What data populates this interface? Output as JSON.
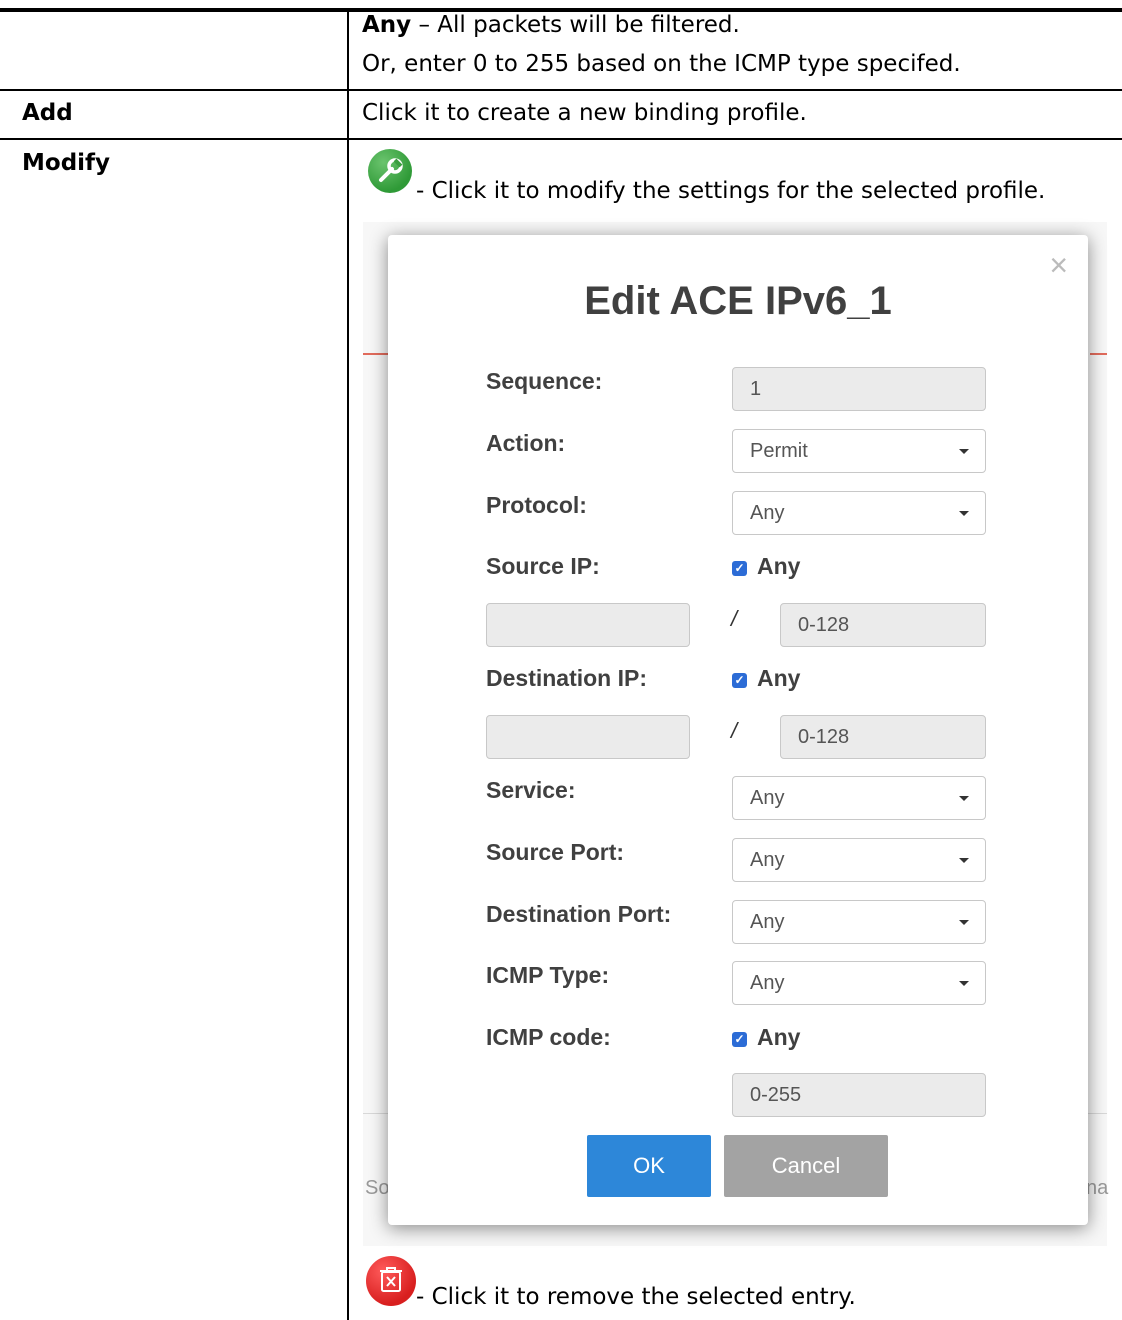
{
  "table": {
    "row_any": {
      "bold": "Any",
      "rest": " – All packets will be filtered.",
      "line2": "Or, enter 0 to 255 based on the ICMP type specifed."
    },
    "row_add": {
      "label": "Add",
      "desc": "Click it to create a new binding profile."
    },
    "row_modify": {
      "label": "Modify",
      "desc": "- Click it to modify the settings for the selected profile.",
      "remove_desc": "- Click it to remove the selected entry."
    }
  },
  "dialog": {
    "title": "Edit ACE IPv6_1",
    "close_symbol": "×",
    "sequence": {
      "label": "Sequence:",
      "value": "1"
    },
    "action": {
      "label": "Action:",
      "value": "Permit"
    },
    "protocol": {
      "label": "Protocol:",
      "value": "Any"
    },
    "source_ip": {
      "label": "Source IP:",
      "any_label": "Any",
      "any_checked": true,
      "slash": "/",
      "prefix_placeholder": "0-128"
    },
    "destination_ip": {
      "label": "Destination IP:",
      "any_label": "Any",
      "any_checked": true,
      "slash": "/",
      "prefix_placeholder": "0-128"
    },
    "service": {
      "label": "Service:",
      "value": "Any"
    },
    "source_port": {
      "label": "Source Port:",
      "value": "Any"
    },
    "destination_port": {
      "label": "Destination Port:",
      "value": "Any"
    },
    "icmp_type": {
      "label": "ICMP Type:",
      "value": "Any"
    },
    "icmp_code": {
      "label": "ICMP code:",
      "any_label": "Any",
      "any_checked": true,
      "placeholder": "0-255"
    },
    "ok_label": "OK",
    "cancel_label": "Cancel"
  },
  "background_partial": {
    "left": "So",
    "right": "na"
  },
  "colors": {
    "wrench_icon": "#3a9e3f",
    "trash_icon": "#e02424",
    "ok_button": "#2d87d9",
    "cancel_button": "#a3a3a3"
  },
  "icons": {
    "modify": "wrench-icon",
    "remove": "trash-icon"
  }
}
